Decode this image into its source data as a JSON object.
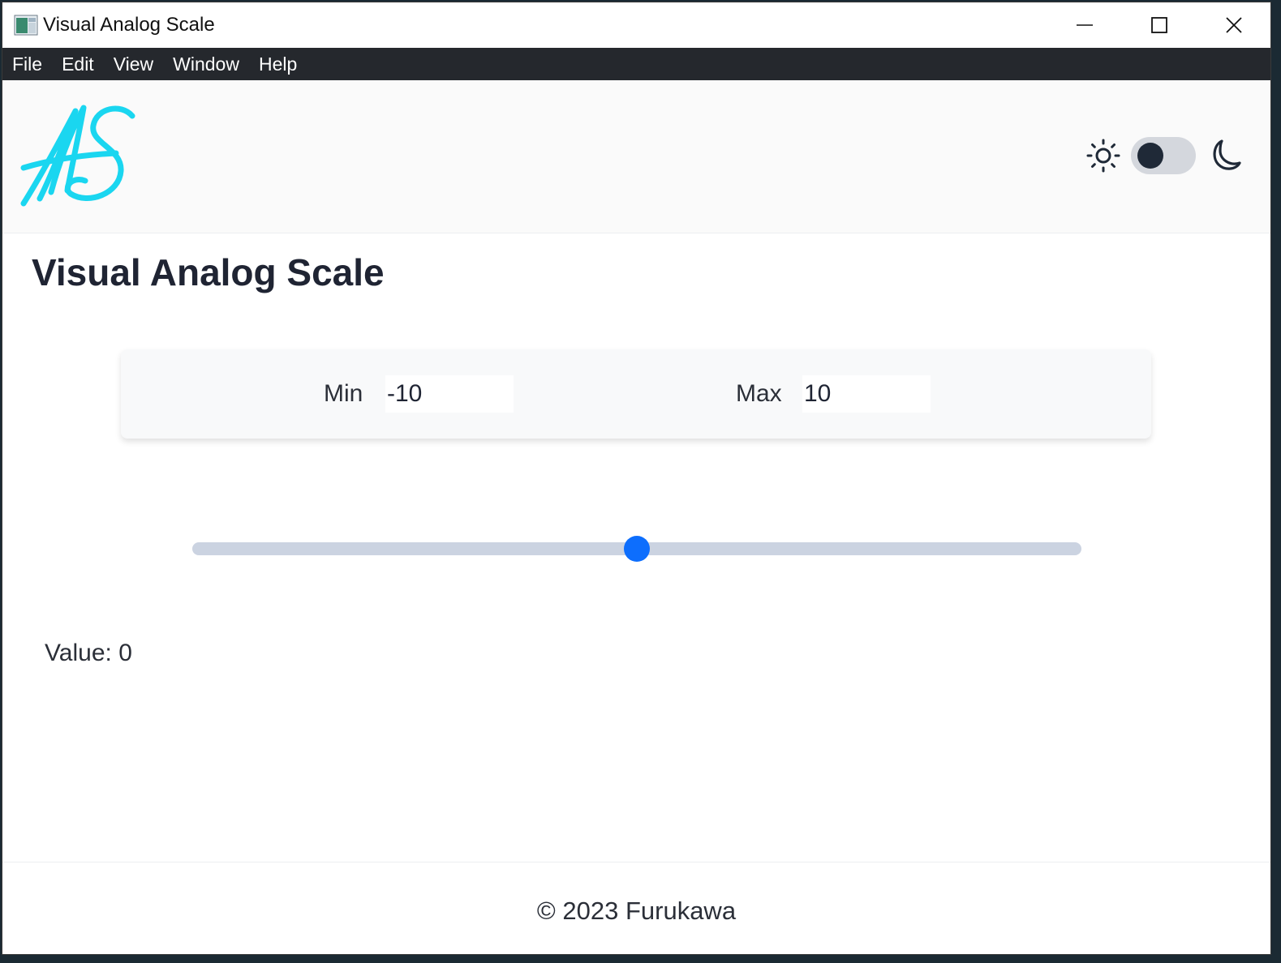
{
  "window": {
    "title": "Visual Analog Scale",
    "icon": "app-icon"
  },
  "menubar": {
    "items": [
      {
        "label": "File"
      },
      {
        "label": "Edit"
      },
      {
        "label": "View"
      },
      {
        "label": "Window"
      },
      {
        "label": "Help"
      }
    ]
  },
  "header": {
    "logo": "signature-logo",
    "theme_toggle": {
      "light_icon": "sun-icon",
      "dark_icon": "moon-icon",
      "dark_mode": false
    }
  },
  "main": {
    "title": "Visual Analog Scale",
    "range": {
      "min_label": "Min",
      "min_value": "-10",
      "max_label": "Max",
      "max_value": "10"
    },
    "slider": {
      "min": -10,
      "max": 10,
      "value": 0
    },
    "value_label": "Value:",
    "value_text": "0"
  },
  "footer": {
    "text": "© 2023 Furukawa"
  },
  "colors": {
    "menubar_bg": "#25282d",
    "logo": "#1ad6f0",
    "slider_track": "#cbd3e1",
    "slider_thumb": "#0d6efd",
    "toggle_knob": "#1f2937"
  }
}
